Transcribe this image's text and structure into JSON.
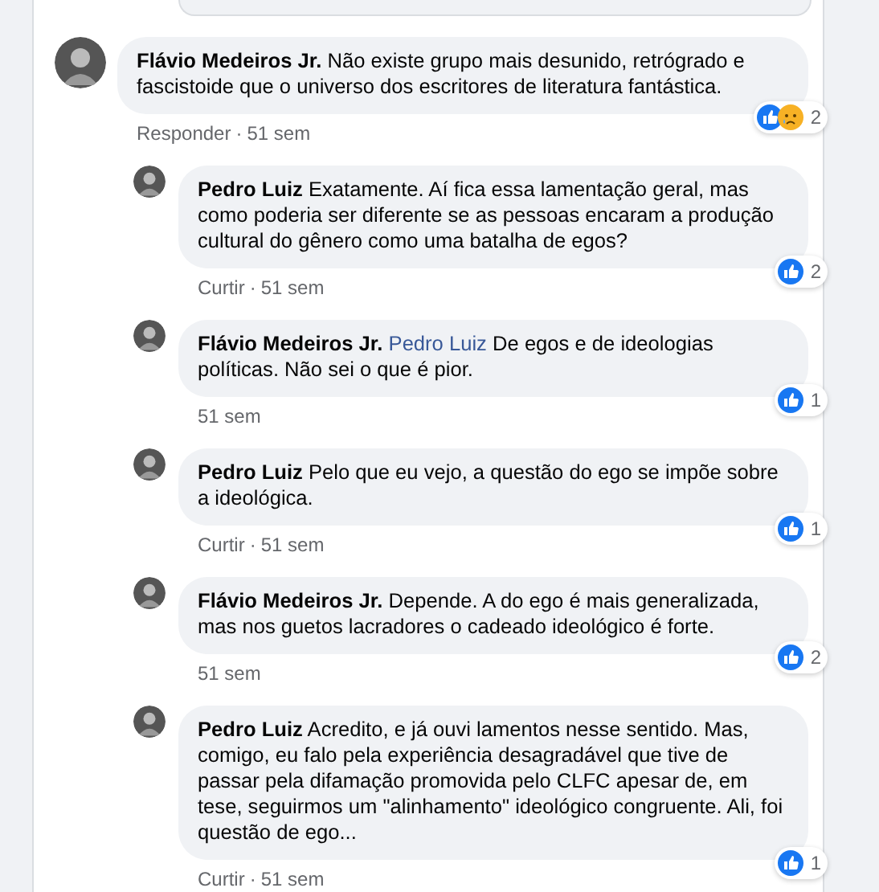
{
  "comments": [
    {
      "author": "Flávio Medeiros Jr.",
      "text": "Não existe grupo mais desunido, retrógrado e fascistoide que o universo dos escritores de literatura fantástica.",
      "reactions": [
        {
          "kind": "like"
        },
        {
          "kind": "sad"
        }
      ],
      "count": "2",
      "action": "Responder",
      "separator": "·",
      "time": "51 sem",
      "replies": [
        {
          "author": "Pedro Luiz",
          "text": "Exatamente. Aí fica essa lamentação geral, mas como poderia ser diferente se as pessoas encaram a produção cultural do gênero como uma batalha de egos?",
          "reactions": [
            {
              "kind": "like"
            }
          ],
          "count": "2",
          "action": "Curtir",
          "separator": "·",
          "time": "51 sem"
        },
        {
          "author": "Flávio Medeiros Jr.",
          "mention": "Pedro Luiz",
          "text": "De egos e de ideologias políticas. Não sei o que é pior.",
          "reactions": [
            {
              "kind": "like"
            }
          ],
          "count": "1",
          "time": "51 sem"
        },
        {
          "author": "Pedro Luiz",
          "text": "Pelo que eu vejo, a questão do ego se impõe sobre a ideológica.",
          "reactions": [
            {
              "kind": "like"
            }
          ],
          "count": "1",
          "action": "Curtir",
          "separator": "·",
          "time": "51 sem"
        },
        {
          "author": "Flávio Medeiros Jr.",
          "text": "Depende. A do ego é mais generalizada, mas nos guetos lacradores o cadeado ideológico é forte.",
          "reactions": [
            {
              "kind": "like"
            }
          ],
          "count": "2",
          "time": "51 sem"
        },
        {
          "author": "Pedro Luiz",
          "text": "Acredito, e já ouvi lamentos nesse sentido. Mas, comigo, eu falo pela experiência desagradável que tive de passar pela difamação promovida pelo CLFC apesar de, em tese, seguirmos um \"alinhamento\" ideológico congruente. Ali, foi questão de ego...",
          "reactions": [
            {
              "kind": "like"
            }
          ],
          "count": "1",
          "action": "Curtir",
          "separator": "·",
          "time": "51 sem"
        }
      ]
    }
  ]
}
